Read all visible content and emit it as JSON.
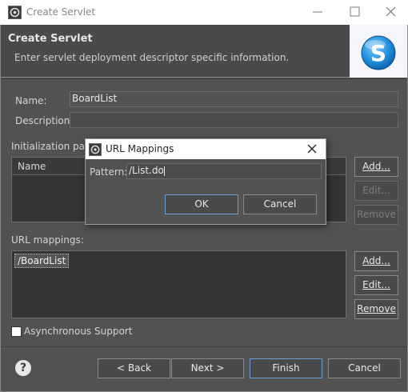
{
  "window": {
    "title": "Create Servlet"
  },
  "banner": {
    "heading": "Create Servlet",
    "description": "Enter servlet deployment descriptor specific information."
  },
  "form": {
    "name_label": "Name:",
    "name_value": "BoardList",
    "description_label": "Description:",
    "description_value": ""
  },
  "init_params": {
    "label": "Initialization para",
    "column_name": "Name",
    "buttons": {
      "add": "Add...",
      "edit": "Edit...",
      "remove": "Remove"
    }
  },
  "url_mappings": {
    "label": "URL mappings:",
    "items": [
      "/BoardList"
    ],
    "buttons": {
      "add": "Add...",
      "edit": "Edit...",
      "remove": "Remove"
    }
  },
  "async": {
    "label": "Asynchronous Support",
    "checked": false
  },
  "footer": {
    "back": "< Back",
    "next": "Next >",
    "finish": "Finish",
    "cancel": "Cancel"
  },
  "modal": {
    "title": "URL Mappings",
    "pattern_label": "Pattern:",
    "pattern_value": "/List.do",
    "ok": "OK",
    "cancel": "Cancel"
  },
  "colors": {
    "dialog_bg": "#525252",
    "default_button_border": "#6aa0d8"
  }
}
